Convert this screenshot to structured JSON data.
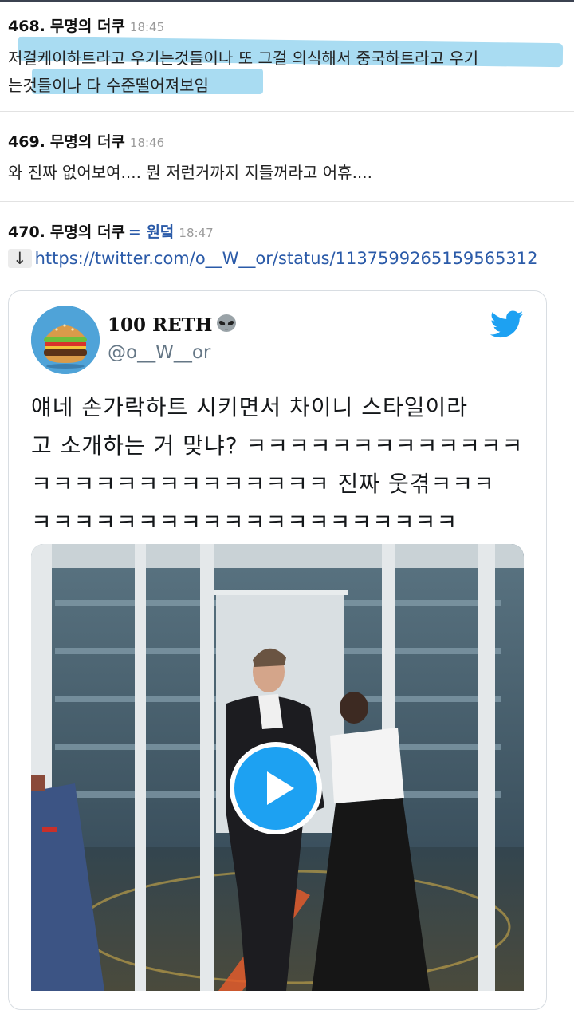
{
  "posts": [
    {
      "number": "468.",
      "author": "무명의 더쿠",
      "time": "18:45",
      "lines": [
        "저걸케이하트라고 우기는것들이나 또 그걸 의식해서 중국하트라고 우기",
        "는것들이나 다 수준떨어져보임"
      ]
    },
    {
      "number": "469.",
      "author": "무명의 더쿠",
      "time": "18:46",
      "lines": [
        "와 진짜 없어보여.... 뭔 저런거까지 지들꺼라고 어휴...."
      ]
    },
    {
      "number": "470.",
      "author": "무명의 더쿠",
      "nickname": "= 원덬",
      "time": "18:47",
      "link_arrow": "↓",
      "link": "https://twitter.com/o__W__or/status/1137599265159565312"
    }
  ],
  "tweet": {
    "display_name": "100 RETH",
    "handle": "@o__W__or",
    "text_lines": [
      "얘네 손가락하트 시키면서 차이니 스타일이라",
      "고 소개하는 거 맞냐? ㅋㅋㅋㅋㅋㅋㅋㅋㅋㅋㅋㅋㅋ",
      "ㅋㅋㅋㅋㅋㅋㅋㅋㅋㅋㅋㅋㅋㅋ 진짜 웃겪ㅋㅋㅋ",
      "ㅋㅋㅋㅋㅋㅋㅋㅋㅋㅋㅋㅋㅋㅋㅋㅋㅋㅋㅋㅋ"
    ],
    "avatar_icon": "burger-icon",
    "badge_icon": "alien-icon",
    "brand_icon": "twitter-bird-icon",
    "play_icon": "play-icon",
    "brand_color": "#1da1f2"
  },
  "colors": {
    "highlight": "#a9dcf2",
    "link": "#2a5aa8",
    "time": "#9a9a9a",
    "separator": "#e2e2e2"
  }
}
